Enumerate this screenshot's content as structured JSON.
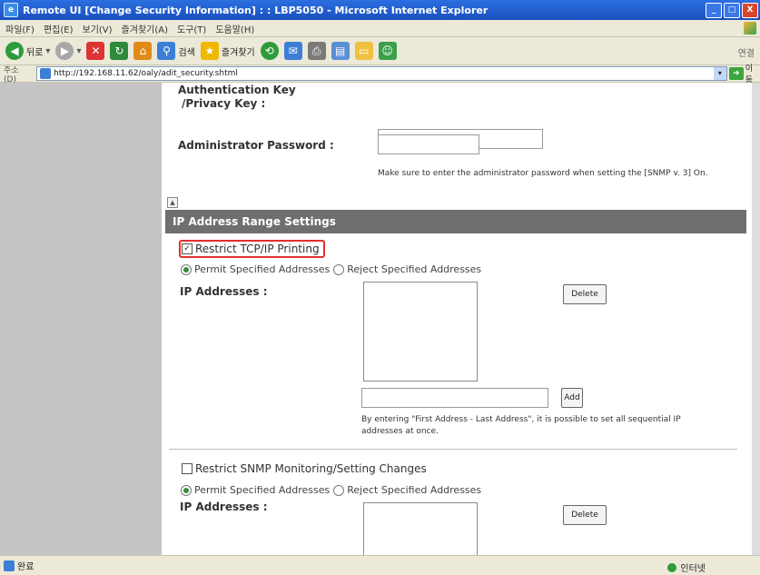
{
  "window": {
    "title": "Remote UI [Change Security Information] : : LBP5050 - Microsoft Internet Explorer",
    "controls": {
      "minimize": "_",
      "maximize": "□",
      "close": "X"
    }
  },
  "menu": [
    "파일(F)",
    "편집(E)",
    "보기(V)",
    "즐겨찾기(A)",
    "도구(T)",
    "도움말(H)"
  ],
  "toolbar": {
    "back_label": "뒤로",
    "search_label": "검색",
    "favorites_label": "즐겨찾기",
    "right_label": "연결"
  },
  "address": {
    "label": "주소(D)",
    "url": "http://192.168.11.62/oaly/adit_security.shtml",
    "go_label": "이동"
  },
  "form": {
    "auth_key_label_1": "Authentication Key",
    "auth_key_label_2": "/Privacy Key :",
    "admin_password_label": "Administrator Password :",
    "admin_password_note": "Make sure to enter the administrator password when setting the [SNMP v. 3] On.",
    "section_title": "IP Address Range Settings",
    "tcpip": {
      "checkbox_label": "Restrict TCP/IP Printing",
      "checked": true,
      "radio_permit": "Permit Specified Addresses",
      "radio_reject": "Reject Specified Addresses",
      "selected": "permit",
      "ip_label": "IP Addresses :",
      "delete_label": "Delete",
      "add_label": "Add",
      "add_note_1": "By entering \"First Address - Last Address\", it is possible to set all sequential IP",
      "add_note_2": "addresses at once."
    },
    "snmp": {
      "checkbox_label": "Restrict SNMP Monitoring/Setting Changes",
      "checked": false,
      "radio_permit": "Permit Specified Addresses",
      "radio_reject": "Reject Specified Addresses",
      "selected": "permit",
      "ip_label": "IP Addresses :",
      "delete_label": "Delete"
    }
  },
  "status": {
    "left_text": "완료",
    "zone_text": "인터넷"
  },
  "colors": {
    "title_bar": "#1a4fbf",
    "section_header": "#6f6f6f",
    "left_pane": "#c5c5c5",
    "highlight_border": "#e0302a"
  }
}
